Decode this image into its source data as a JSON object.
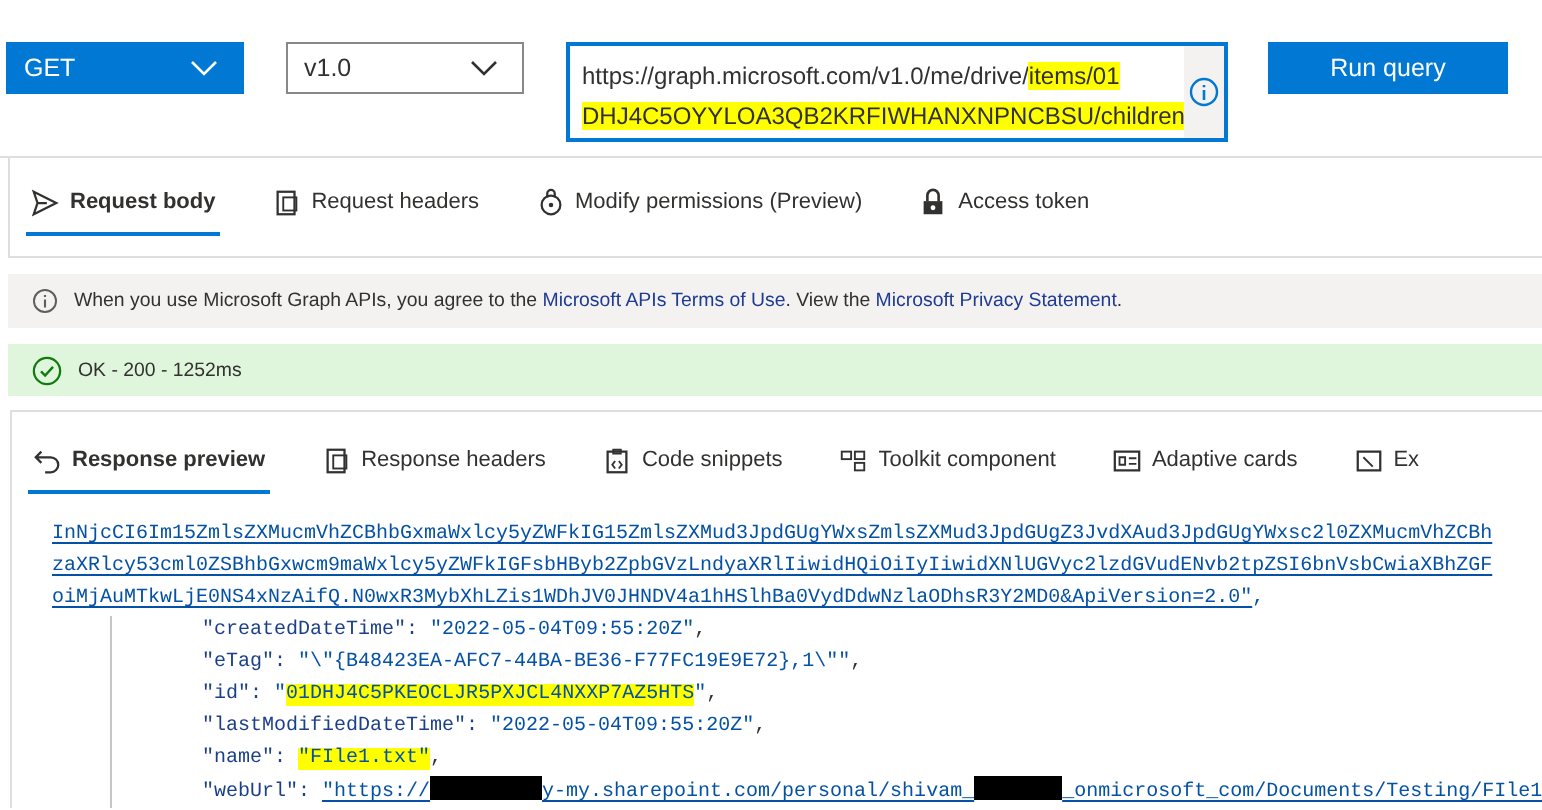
{
  "query_bar": {
    "method": "GET",
    "version": "v1.0",
    "url_lines": [
      [
        {
          "text": "https://graph.microsoft.com/v1.0/me/drive/",
          "highlighted": false
        },
        {
          "text": "items/01",
          "highlighted": true
        }
      ],
      [
        {
          "text": "DHJ4C5OYYLOA3QB2KRFIWHANXNPNCBSU/children",
          "highlighted": true
        }
      ]
    ],
    "run_button": "Run query"
  },
  "request_tabs": [
    {
      "label": "Request body",
      "kind": "send",
      "selected": true
    },
    {
      "label": "Request headers",
      "kind": "headers",
      "selected": false
    },
    {
      "label": "Modify permissions (Preview)",
      "kind": "permissions",
      "selected": false
    },
    {
      "label": "Access token",
      "kind": "token",
      "selected": false
    }
  ],
  "notice": {
    "parts": [
      {
        "kind": "text",
        "text": "When you use Microsoft Graph APIs, you agree to the "
      },
      {
        "kind": "link",
        "text": "Microsoft APIs Terms of Use"
      },
      {
        "kind": "text",
        "text": ". View the "
      },
      {
        "kind": "link",
        "text": "Microsoft Privacy Statement"
      },
      {
        "kind": "text",
        "text": "."
      }
    ]
  },
  "status": {
    "kind": "success",
    "text": "OK - 200 - 1252ms"
  },
  "response_tabs": [
    {
      "label": "Response preview",
      "kind": "preview",
      "selected": true
    },
    {
      "label": "Response headers",
      "kind": "headers",
      "selected": false
    },
    {
      "label": "Code snippets",
      "kind": "snippets",
      "selected": false
    },
    {
      "label": "Toolkit component",
      "kind": "toolkit",
      "selected": false
    },
    {
      "label": "Adaptive cards",
      "kind": "cards",
      "selected": false
    },
    {
      "label": "Ex",
      "kind": "export",
      "selected": false
    }
  ],
  "code_lines": [
    {
      "kind": "link",
      "text": "InNjcCI6Im15ZmlsZXMucmVhZCBhbGxmaWxlcy5yZWFkIG15ZmlsZXMud3JpdGUgYWxsZmlsZXMud3JpdGUgZ3JvdXAud3JpdGUgYWxsc2l0ZXMucmVhZCBh"
    },
    {
      "kind": "link",
      "text": "zaXRlcy53cml0ZSBhbGxwcm9maWxlcy5yZWFkIGFsbHByb2ZpbGVzLndyaXRlIiwidHQiOiIyIiwidXNlUGVyc2lzdGVudENvb2tpZSI6bnVsbCwiaXBhZGF"
    },
    {
      "kind": "link",
      "text": "oiMjAuMTkwLjE0NS4xNzAifQ.N0wxR3MybXhLZis1WDhJV0JHNDV4a1hHSlhBa0VydDdwNzlaODhsR3Y2MD0&ApiVersion=2.0\"",
      "trailing": ","
    },
    {
      "kind": "property",
      "key": "\"createdDateTime\":",
      "parts": [
        {
          "kind": "text",
          "text": "\"2022-05-04T09:55:20Z\""
        }
      ],
      "trailing": ","
    },
    {
      "kind": "property",
      "key": "\"eTag\":",
      "parts": [
        {
          "kind": "text",
          "text": "\"\\\"{B48423EA-AFC7-44BA-BE36-F77FC19E9E72},1\\\"\""
        }
      ],
      "trailing": ","
    },
    {
      "kind": "property",
      "key": "\"id\":",
      "parts": [
        {
          "kind": "text",
          "text": "\""
        },
        {
          "kind": "highlight",
          "text": "01DHJ4C5PKEOCLJR5PXJCL4NXXP7AZ5HTS"
        },
        {
          "kind": "text",
          "text": "\""
        }
      ],
      "trailing": ","
    },
    {
      "kind": "property",
      "key": "\"lastModifiedDateTime\":",
      "parts": [
        {
          "kind": "text",
          "text": "\"2022-05-04T09:55:20Z\""
        }
      ],
      "trailing": ","
    },
    {
      "kind": "property",
      "key": "\"name\":",
      "parts": [
        {
          "kind": "highlight",
          "text": "\"FIle1.txt\""
        }
      ],
      "trailing": ","
    },
    {
      "kind": "property",
      "key": "\"webUrl\":",
      "link": true,
      "parts": [
        {
          "kind": "text",
          "text": "\"https://"
        },
        {
          "kind": "redaction"
        },
        {
          "kind": "text",
          "text": "y-my.sharepoint.com/personal/shivam_"
        },
        {
          "kind": "redaction"
        },
        {
          "kind": "text",
          "text": "_onmicrosoft_com/Documents/Testing/FIle1"
        }
      ]
    }
  ]
}
